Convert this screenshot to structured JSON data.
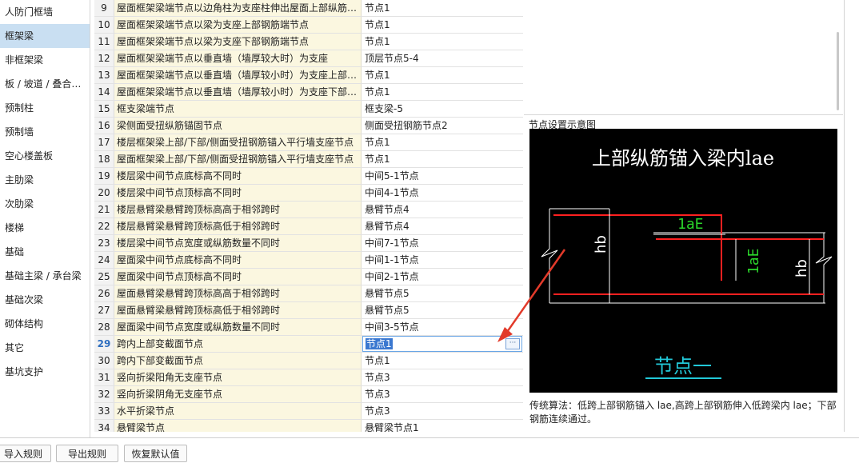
{
  "sidebar": {
    "items": [
      {
        "label": "人防门框墙",
        "selected": false
      },
      {
        "label": "框架梁",
        "selected": true
      },
      {
        "label": "非框架梁",
        "selected": false
      },
      {
        "label": "板 / 坡道 / 叠合…",
        "selected": false
      },
      {
        "label": "预制柱",
        "selected": false
      },
      {
        "label": "预制墙",
        "selected": false
      },
      {
        "label": "空心楼盖板",
        "selected": false
      },
      {
        "label": "主肋梁",
        "selected": false
      },
      {
        "label": "次肋梁",
        "selected": false
      },
      {
        "label": "楼梯",
        "selected": false
      },
      {
        "label": "基础",
        "selected": false
      },
      {
        "label": "基础主梁 / 承台梁",
        "selected": false
      },
      {
        "label": "基础次梁",
        "selected": false
      },
      {
        "label": "砌体结构",
        "selected": false
      },
      {
        "label": "其它",
        "selected": false
      },
      {
        "label": "基坑支护",
        "selected": false
      }
    ]
  },
  "table": {
    "rows": [
      {
        "num": "9",
        "name": "屋面框架梁端节点以边角柱为支座柱伸出屋面上部纵筋…",
        "value": "节点1"
      },
      {
        "num": "10",
        "name": "屋面框架梁端节点以梁为支座上部钢筋端节点",
        "value": "节点1"
      },
      {
        "num": "11",
        "name": "屋面框架梁端节点以梁为支座下部钢筋端节点",
        "value": "节点1"
      },
      {
        "num": "12",
        "name": "屋面框架梁端节点以垂直墙（墙厚较大时）为支座",
        "value": "顶层节点5-4"
      },
      {
        "num": "13",
        "name": "屋面框架梁端节点以垂直墙（墙厚较小时）为支座上部…",
        "value": "节点1"
      },
      {
        "num": "14",
        "name": "屋面框架梁端节点以垂直墙（墙厚较小时）为支座下部…",
        "value": "节点1"
      },
      {
        "num": "15",
        "name": "框支梁端节点",
        "value": "框支梁-5"
      },
      {
        "num": "16",
        "name": "梁侧面受扭纵筋锚固节点",
        "value": "侧面受扭钢筋节点2"
      },
      {
        "num": "17",
        "name": "楼层框架梁上部/下部/侧面受扭钢筋锚入平行墙支座节点",
        "value": "节点1"
      },
      {
        "num": "18",
        "name": "屋面框架梁上部/下部/侧面受扭钢筋锚入平行墙支座节点",
        "value": "节点1"
      },
      {
        "num": "19",
        "name": "楼层梁中间节点底标高不同时",
        "value": "中间5-1节点"
      },
      {
        "num": "20",
        "name": "楼层梁中间节点顶标高不同时",
        "value": "中间4-1节点"
      },
      {
        "num": "21",
        "name": "楼层悬臂梁悬臂跨顶标高高于相邻跨时",
        "value": "悬臂节点4"
      },
      {
        "num": "22",
        "name": "楼层悬臂梁悬臂跨顶标高低于相邻跨时",
        "value": "悬臂节点4"
      },
      {
        "num": "23",
        "name": "楼层梁中间节点宽度或纵筋数量不同时",
        "value": "中间7-1节点"
      },
      {
        "num": "24",
        "name": "屋面梁中间节点底标高不同时",
        "value": "中间1-1节点"
      },
      {
        "num": "25",
        "name": "屋面梁中间节点顶标高不同时",
        "value": "中间2-1节点"
      },
      {
        "num": "26",
        "name": "屋面悬臂梁悬臂跨顶标高高于相邻跨时",
        "value": "悬臂节点5"
      },
      {
        "num": "27",
        "name": "屋面悬臂梁悬臂跨顶标高低于相邻跨时",
        "value": "悬臂节点5"
      },
      {
        "num": "28",
        "name": "屋面梁中间节点宽度或纵筋数量不同时",
        "value": "中间3-5节点"
      },
      {
        "num": "29",
        "name": "跨内上部变截面节点",
        "value": "节点1",
        "active": true
      },
      {
        "num": "30",
        "name": "跨内下部变截面节点",
        "value": "节点1"
      },
      {
        "num": "31",
        "name": "竖向折梁阳角无支座节点",
        "value": "节点3"
      },
      {
        "num": "32",
        "name": "竖向折梁阴角无支座节点",
        "value": "节点3"
      },
      {
        "num": "33",
        "name": "水平折梁节点",
        "value": "节点3"
      },
      {
        "num": "34",
        "name": "悬臂梁节点",
        "value": "悬臂梁节点1"
      }
    ],
    "ellipsis_label": "···"
  },
  "preview": {
    "title": "节点设置示意图",
    "diagram": {
      "heading": "上部纵筋锚入梁内lae",
      "label_lae_h": "1aE",
      "label_lae_v": "1aE",
      "label_hb_left": "hb",
      "label_hb_right": "hb",
      "caption": "节点一",
      "colors": {
        "rebar": "#ff2020",
        "lines": "#ffffff",
        "label": "#2bd62b",
        "caption": "#22c8d8",
        "arrow": "#e23a2a"
      }
    },
    "description": "传统算法：低跨上部钢筋锚入 lae,高跨上部钢筋伸入低跨梁内 lae；下部钢筋连续通过。"
  },
  "buttons": {
    "import": "导入规则",
    "export": "导出规则",
    "restore": "恢复默认值"
  }
}
